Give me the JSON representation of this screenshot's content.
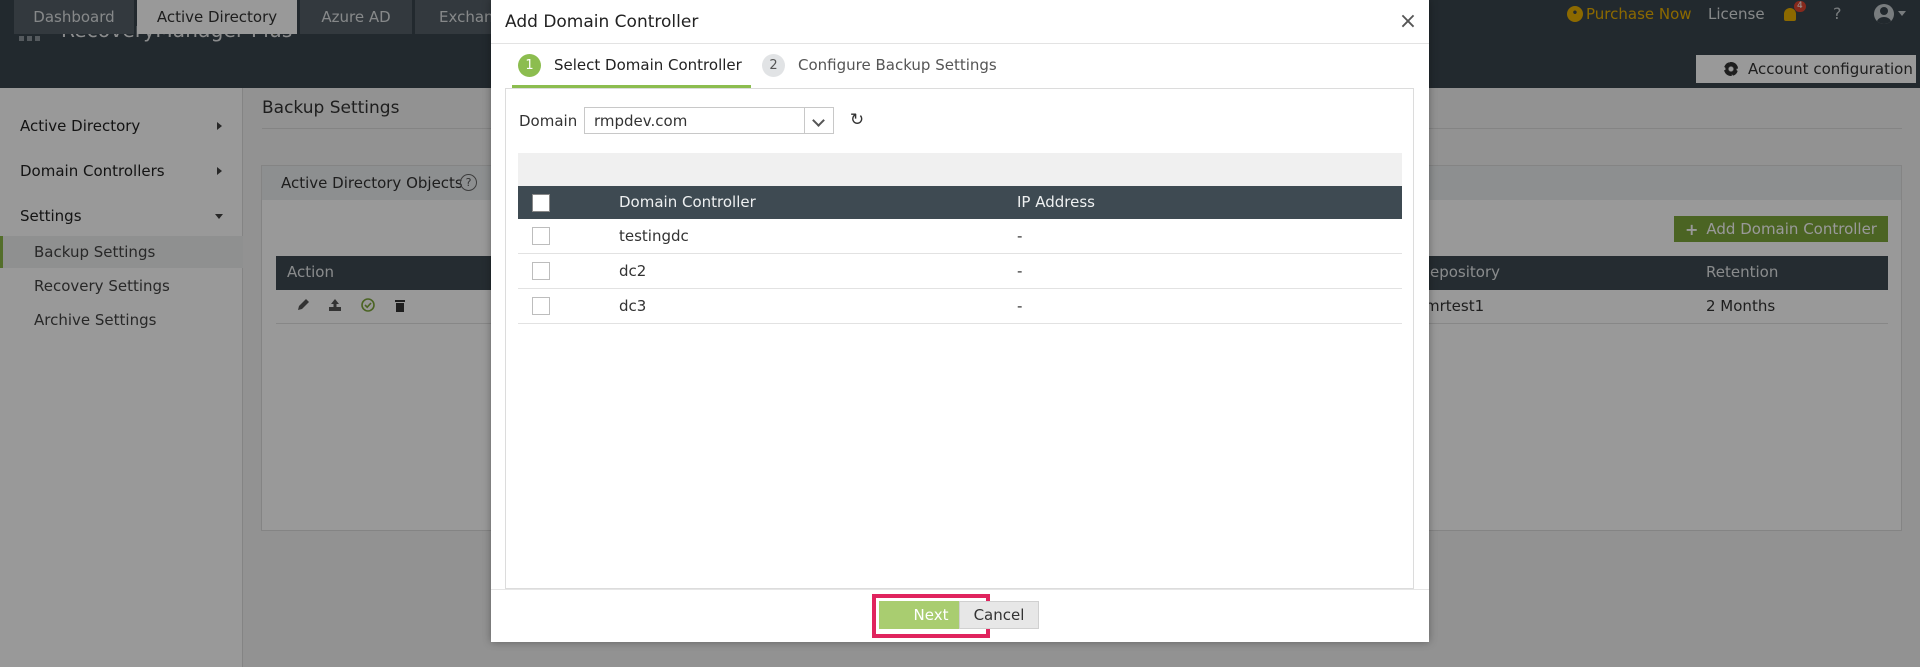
{
  "app": {
    "name": "RecoveryManager Plus"
  },
  "header": {
    "purchase_label": "Purchase Now",
    "license_label": "License",
    "notification_count": "4",
    "help_label": "?"
  },
  "nav": {
    "tabs": [
      {
        "label": "Dashboard"
      },
      {
        "label": "Active Directory"
      },
      {
        "label": "Azure AD"
      },
      {
        "label": "Exchan"
      }
    ],
    "account_config_label": "Account configuration"
  },
  "sidebar": {
    "sections": [
      {
        "label": "Active Directory"
      },
      {
        "label": "Domain Controllers"
      },
      {
        "label": "Settings"
      }
    ],
    "items": [
      {
        "label": "Backup Settings"
      },
      {
        "label": "Recovery Settings"
      },
      {
        "label": "Archive Settings"
      }
    ]
  },
  "main": {
    "page_title": "Backup Settings",
    "panel_title": "Active Directory Objects",
    "add_dc_label": "Add Domain Controller",
    "grid_columns": {
      "action": "Action",
      "repository": "epository",
      "retention": "Retention"
    },
    "grid_row": {
      "repository": "mrtest1",
      "retention": "2 Months"
    }
  },
  "modal": {
    "title": "Add Domain Controller",
    "close_glyph": "×",
    "steps": [
      {
        "num": "1",
        "label": "Select Domain Controller"
      },
      {
        "num": "2",
        "label": "Configure Backup Settings"
      }
    ],
    "domain_label": "Domain",
    "domain_value": "rmpdev.com",
    "columns": {
      "dc": "Domain Controller",
      "ip": "IP Address"
    },
    "rows": [
      {
        "dc": "testingdc",
        "ip": "-"
      },
      {
        "dc": "dc2",
        "ip": "-"
      },
      {
        "dc": "dc3",
        "ip": "-"
      }
    ],
    "next_label": "Next",
    "cancel_label": "Cancel"
  },
  "colors": {
    "header_bg": "#3a454d",
    "accent_green": "#8cbd4f",
    "brand_gold": "#e9b000",
    "highlight_pink": "#e0245e"
  }
}
